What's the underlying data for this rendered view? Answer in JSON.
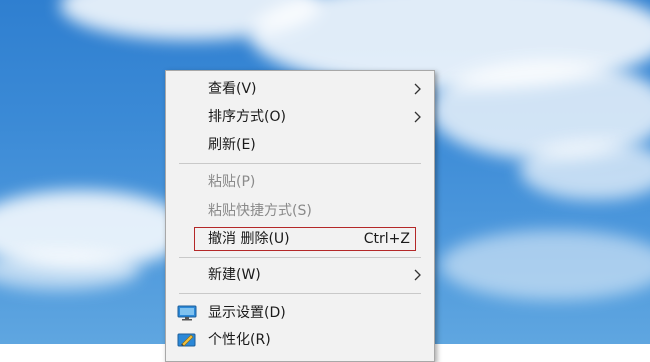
{
  "context_menu": {
    "items": [
      {
        "label": "查看(V)",
        "submenu": true,
        "enabled": true,
        "icon": null
      },
      {
        "label": "排序方式(O)",
        "submenu": true,
        "enabled": true,
        "icon": null
      },
      {
        "label": "刷新(E)",
        "submenu": false,
        "enabled": true,
        "icon": null
      },
      {
        "label": "粘贴(P)",
        "submenu": false,
        "enabled": false,
        "icon": null
      },
      {
        "label": "粘贴快捷方式(S)",
        "submenu": false,
        "enabled": false,
        "icon": null
      },
      {
        "label": "撤消 删除(U)",
        "shortcut": "Ctrl+Z",
        "submenu": false,
        "enabled": true,
        "highlighted": true,
        "icon": null
      },
      {
        "label": "新建(W)",
        "submenu": true,
        "enabled": true,
        "icon": null
      },
      {
        "label": "显示设置(D)",
        "submenu": false,
        "enabled": true,
        "icon": "display-settings-icon"
      },
      {
        "label": "个性化(R)",
        "submenu": false,
        "enabled": true,
        "icon": "personalize-icon"
      }
    ]
  },
  "colors": {
    "menu_background": "#f2f2f2",
    "highlight_border": "#b42828",
    "disabled_text": "#8a8a8a",
    "desktop_sky": "#3b8ad6"
  }
}
